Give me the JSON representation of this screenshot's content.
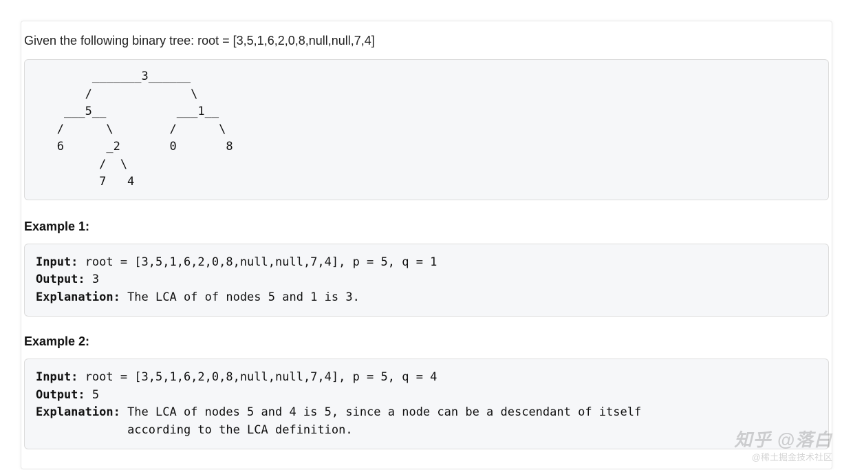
{
  "intro": "Given the following binary tree:  root = [3,5,1,6,2,0,8,null,null,7,4]",
  "tree_diagram": "        _______3______\n       /              \\\n    ___5__          ___1__\n   /      \\        /      \\\n   6      _2       0       8\n         /  \\\n         7   4",
  "examples": [
    {
      "heading": "Example 1:",
      "input_label": "Input:",
      "input_value": " root = [3,5,1,6,2,0,8,null,null,7,4], p = 5, q = 1",
      "output_label": "Output:",
      "output_value": " 3",
      "explanation_label": "Explanation:",
      "explanation_value": " The LCA of of nodes 5 and 1 is 3."
    },
    {
      "heading": "Example 2:",
      "input_label": "Input:",
      "input_value": " root = [3,5,1,6,2,0,8,null,null,7,4], p = 5, q = 4",
      "output_label": "Output:",
      "output_value": " 5",
      "explanation_label": "Explanation:",
      "explanation_value": " The LCA of nodes 5 and 4 is 5, since a node can be a descendant of itself\n             according to the LCA definition."
    }
  ],
  "watermark": {
    "top": "知乎 @落白",
    "bottom": "@稀土掘金技术社区"
  }
}
